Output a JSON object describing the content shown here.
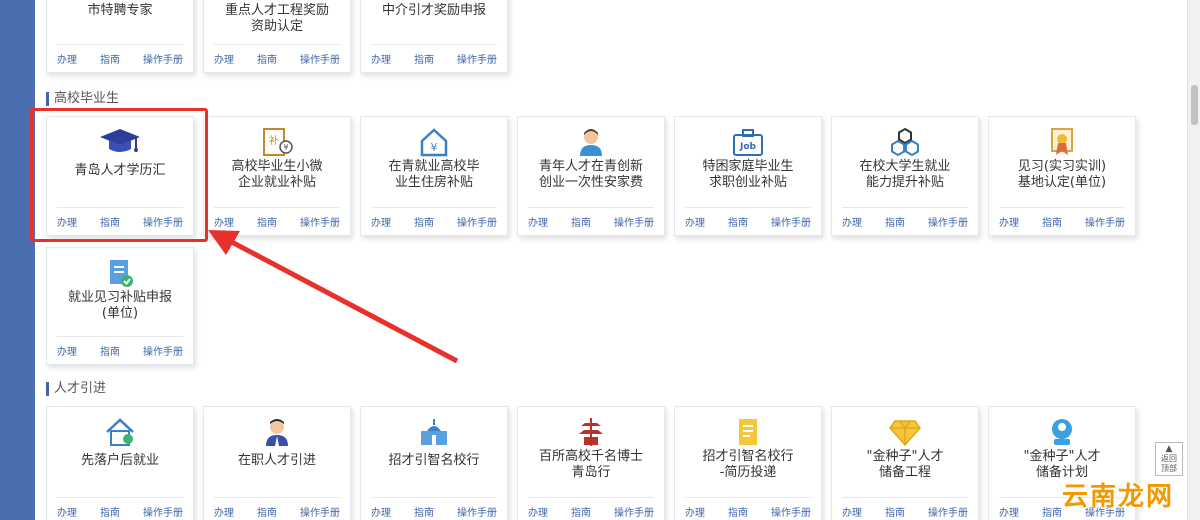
{
  "sections": {
    "colleges": "高校毕业生",
    "talent": "人才引进"
  },
  "actions": {
    "handle": "办理",
    "guide": "指南",
    "manual": "操作手册"
  },
  "top_row": [
    {
      "title": "市特聘专家"
    },
    {
      "title": "重点人才工程奖励\n资助认定"
    },
    {
      "title": "中介引才奖励申报"
    }
  ],
  "college_cards": [
    {
      "title": "青岛人才学历汇",
      "icon": "graduation-cap-icon"
    },
    {
      "title": "高校毕业生小微\n企业就业补贴",
      "icon": "subsidy-document-icon"
    },
    {
      "title": "在青就业高校毕\n业生住房补贴",
      "icon": "house-yuan-icon"
    },
    {
      "title": "青年人才在青创新\n创业一次性安家费",
      "icon": "young-person-icon"
    },
    {
      "title": "特困家庭毕业生\n求职创业补贴",
      "icon": "job-briefcase-icon"
    },
    {
      "title": "在校大学生就业\n能力提升补贴",
      "icon": "hexagon-network-icon"
    },
    {
      "title": "见习(实习实训)\n基地认定(单位)",
      "icon": "certificate-icon"
    },
    {
      "title": "就业见习补贴申报\n(单位)",
      "icon": "form-check-icon"
    }
  ],
  "talent_cards": [
    {
      "title": "先落户后就业",
      "icon": "house-badge-icon"
    },
    {
      "title": "在职人才引进",
      "icon": "professional-icon"
    },
    {
      "title": "招才引智名校行",
      "icon": "campus-building-icon"
    },
    {
      "title": "百所高校千名博士\n青岛行",
      "icon": "pagoda-icon"
    },
    {
      "title": "招才引智名校行\n-简历投递",
      "icon": "resume-icon"
    },
    {
      "title": "\"金种子\"人才\n储备工程",
      "icon": "diamond-icon"
    },
    {
      "title": "\"金种子\"人才\n储备计划",
      "icon": "clipboard-person-icon"
    }
  ],
  "back_to_top": "返回\n顶部",
  "watermark": "云南龙网",
  "colors": {
    "accent": "#3f66a8",
    "highlight": "#e8302c",
    "background": "#4a6fb0"
  }
}
